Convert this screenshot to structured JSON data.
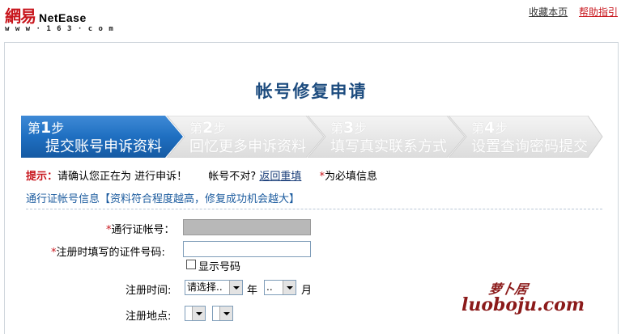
{
  "header": {
    "logo_cn": "網易",
    "logo_en": "NetEase",
    "logo_url": "w w w · 1 6 3 · c o m",
    "links": {
      "favorite": "收藏本页",
      "help": "帮助指引"
    }
  },
  "page": {
    "title": "帐号修复申请"
  },
  "steps": [
    {
      "num_prefix": "第",
      "num": "1",
      "num_suffix": "步",
      "label": "提交账号申诉资料",
      "active": true
    },
    {
      "num_prefix": "第",
      "num": "2",
      "num_suffix": "步",
      "label": "回忆更多申诉资料",
      "active": false
    },
    {
      "num_prefix": "第",
      "num": "3",
      "num_suffix": "步",
      "label": "填写真实联系方式",
      "active": false
    },
    {
      "num_prefix": "第",
      "num": "4",
      "num_suffix": "步",
      "label": "设置查询密码提交",
      "active": false
    }
  ],
  "notice": {
    "label": "提示：",
    "text": "请确认您正在为 进行申诉！",
    "wrong_account": "帐号不对?",
    "reset_link": "返回重填",
    "required_star": "*",
    "required_text": "为必填信息"
  },
  "section": {
    "title": "通行证帐号信息【资料符合程度越高，修复成功机会越大】"
  },
  "form": {
    "account_label": "通行证帐号：",
    "account_value": "",
    "id_label": "注册时填写的证件号码:",
    "id_value": "",
    "show_number_label": "显示号码",
    "show_number_checked": false,
    "reg_time_label": "注册时间:",
    "year_select": "请选择..",
    "year_unit": "年",
    "month_select": "..",
    "month_unit": "月",
    "reg_place_label": "注册地点:",
    "place_select_1": "",
    "place_select_2": ""
  },
  "watermark": {
    "cn": "萝卜居",
    "en": "luoboju.com"
  },
  "colors": {
    "active_step": "#1f6fc1",
    "inactive_step": "#e6e6e6",
    "title": "#1d4c7f",
    "accent_red": "#c8161d"
  }
}
